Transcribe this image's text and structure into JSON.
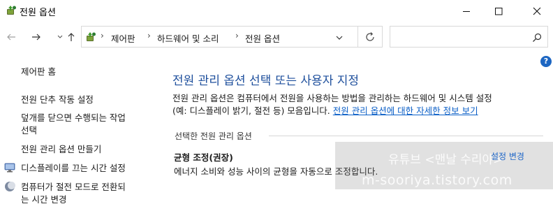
{
  "window": {
    "title": "전원 옵션"
  },
  "address_bar": {
    "breadcrumb": [
      "제어판",
      "하드웨어 및 소리",
      "전원 옵션"
    ]
  },
  "search": {
    "placeholder": ""
  },
  "sidebar": {
    "home": "제어판 홈",
    "tasks": [
      {
        "label": "전원 단추 작동 설정",
        "icon": null
      },
      {
        "label_lines": [
          "덮개를 닫으면 수행되는 작업",
          "선택"
        ],
        "icon": null
      },
      {
        "label": "전원 관리 옵션 만들기",
        "icon": null
      },
      {
        "label": "디스플레이를 끄는 시간 설정",
        "icon": "monitor-icon"
      },
      {
        "label_lines": [
          "컴퓨터가 절전 모드로 전환되",
          "는 시간 변경"
        ],
        "icon": "sleep-moon-icon"
      }
    ]
  },
  "main": {
    "title": "전원 관리 옵션 선택 또는 사용자 지정",
    "description_line1": "전원 관리 옵션은 컴퓨터에서 전원을 사용하는 방법을 관리하는 하드웨어 및 시스템 설정",
    "description_line2_prefix": "(예: 디스플레이 밝기, 절전 등) 모음입니다.",
    "description_link": "전원 관리 옵션에 대한 자세한 정보 보기",
    "section_label": "선택한 전원 관리 옵션",
    "plan": {
      "name": "균형 조정(권장)",
      "description": "에너지 소비와 성능 사이의 균형을 자동으로 조정합니다.",
      "change_link": "설정 변경"
    }
  },
  "watermark": {
    "line1": "유튜브 <맨날 수리야>",
    "line2": "m-sooriya.tistory.com"
  },
  "colors": {
    "title_blue": "#1e4f9c",
    "link_blue": "#0b5fc7",
    "help_blue": "#1d66c2"
  }
}
